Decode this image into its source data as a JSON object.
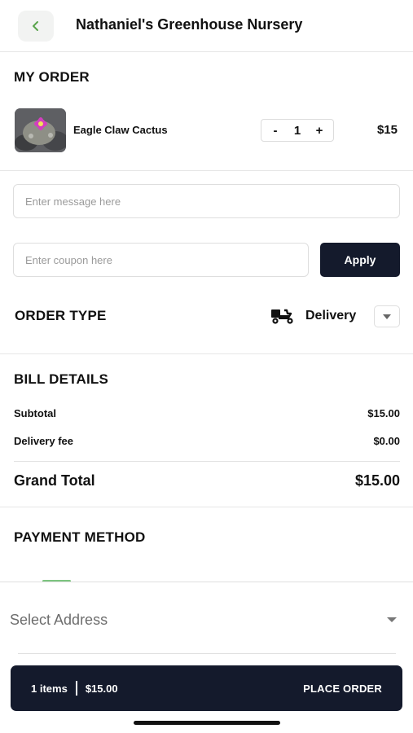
{
  "header": {
    "title": "Nathaniel's Greenhouse Nursery",
    "back_icon": "chevron-left-icon",
    "back_icon_color": "#5aa44c"
  },
  "my_order": {
    "title": "MY ORDER",
    "items": [
      {
        "name": "Eagle Claw Cactus",
        "quantity": "1",
        "decrement_label": "-",
        "increment_label": "+",
        "price": "$15"
      }
    ]
  },
  "message": {
    "placeholder": "Enter message here"
  },
  "coupon": {
    "placeholder": "Enter coupon here",
    "apply_label": "Apply"
  },
  "order_type": {
    "title": "ORDER TYPE",
    "value": "Delivery",
    "icon": "delivery-scooter-icon"
  },
  "bill": {
    "title": "BILL DETAILS",
    "rows": [
      {
        "label": "Subtotal",
        "value": "$15.00"
      },
      {
        "label": "Delivery fee",
        "value": "$0.00"
      }
    ],
    "grand_total_label": "Grand Total",
    "grand_total_value": "$15.00"
  },
  "payment": {
    "title": "PAYMENT METHOD"
  },
  "address": {
    "label": "Select Address"
  },
  "footer": {
    "items_count": "1 items",
    "total": "$15.00",
    "place_order_label": "PLACE ORDER"
  },
  "colors": {
    "primary_dark": "#141a2c",
    "accent_green": "#5aa44c"
  }
}
